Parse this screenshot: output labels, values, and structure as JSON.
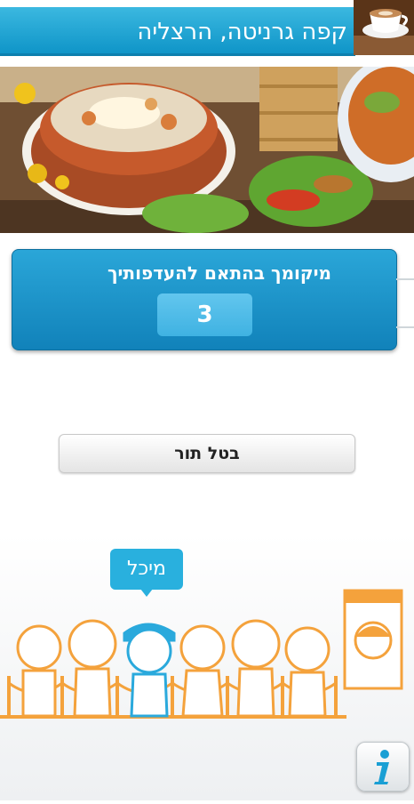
{
  "header": {
    "title": "קפה גרניטה, הרצליה"
  },
  "queue": {
    "label": "מיקומך בהתאם להעדפותיך",
    "position": "3"
  },
  "actions": {
    "cancel_label": "בטל תור"
  },
  "illustration": {
    "name_label": "מיכל"
  },
  "colors": {
    "accent": "#1a9fd4",
    "card_blue": "#1182ba",
    "queue_orange": "#f4a23c",
    "figure_blue": "#2aa9dc"
  },
  "icons": {
    "info": "info-icon"
  }
}
